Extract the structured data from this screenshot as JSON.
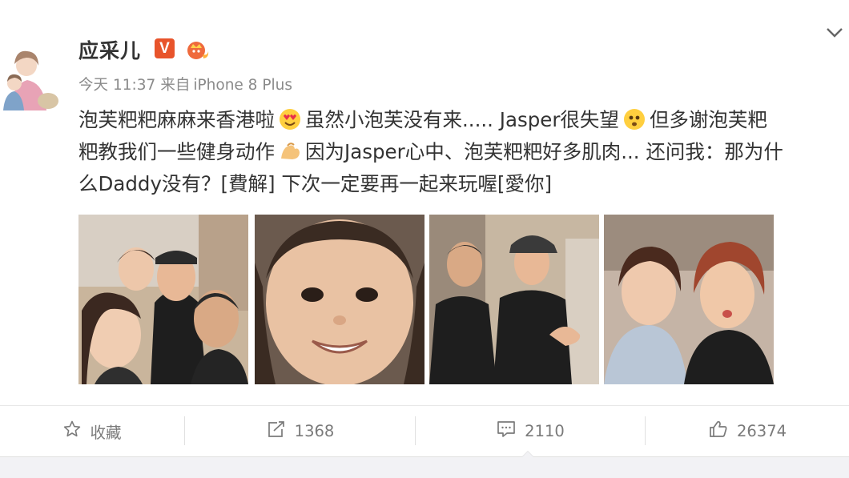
{
  "user": {
    "name": "应采儿",
    "verified_badge": "V"
  },
  "meta": {
    "time_day": "今天",
    "time_clock": "11:37",
    "source_prefix": "来自",
    "source_device": "iPhone 8 Plus"
  },
  "post": {
    "segments": [
      "泡芙粑粑麻麻来香港啦",
      "虽然小泡芙没有来..... Jasper很失望",
      "但多谢泡芙粑",
      "粑教我们一些健身动作",
      "因为Jasper心中、泡芙粑粑好多肌肉... 还问我：那为什",
      "么Daddy没有？[費解] 下次一定要再一起来玩喔[愛你]"
    ],
    "emojis": [
      "heart-eyes-emoji",
      "worried-emoji",
      "flexed-biceps-emoji"
    ]
  },
  "photos": [
    {
      "name": "group-selfie-photo"
    },
    {
      "name": "child-closeup-photo"
    },
    {
      "name": "two-men-photo"
    },
    {
      "name": "two-women-photo"
    }
  ],
  "actions": {
    "favorite_label": "收藏",
    "repost_count": "1368",
    "comment_count": "2110",
    "like_count": "26374"
  },
  "colors": {
    "text": "#333333",
    "meta": "#8a8a8a",
    "action": "#7a7a7a",
    "badge_orange": "#e8542b",
    "divider": "#e8e8e8"
  }
}
